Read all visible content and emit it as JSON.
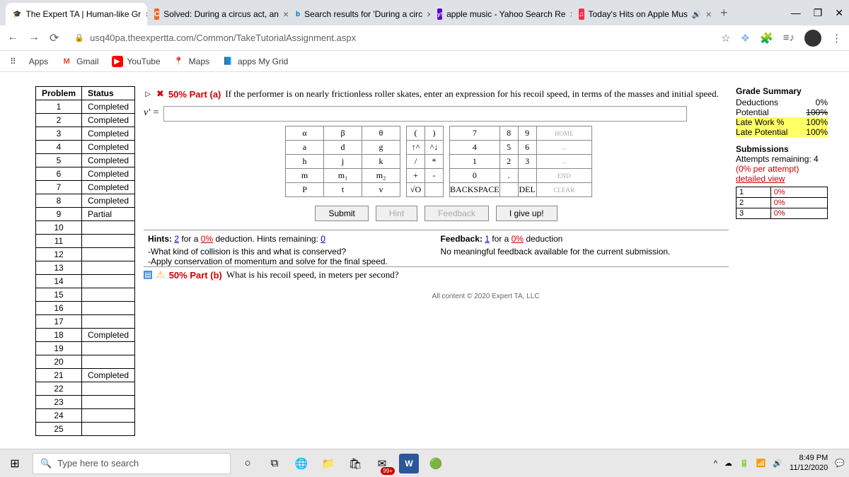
{
  "browser": {
    "tabs": [
      {
        "title": "The Expert TA | Human-like Gr",
        "favicon": "🎓"
      },
      {
        "title": "Solved: During a circus act, an",
        "favicon": "C"
      },
      {
        "title": "Search results for 'During a circ",
        "favicon": "b"
      },
      {
        "title": "apple music - Yahoo Search Re",
        "favicon": "y!"
      },
      {
        "title": "Today's Hits on Apple Mus",
        "favicon": "♫"
      }
    ],
    "url": "usq40pa.theexpertta.com/Common/TakeTutorialAssignment.aspx",
    "bookmarks_label": "Apps",
    "bookmarks": [
      {
        "label": "Gmail",
        "icon": "M"
      },
      {
        "label": "YouTube",
        "icon": "▶"
      },
      {
        "label": "Maps",
        "icon": "📍"
      },
      {
        "label": "apps My Grid",
        "icon": "📘"
      }
    ]
  },
  "status_header": {
    "col1": "Problem",
    "col2": "Status"
  },
  "status": [
    {
      "n": "1",
      "s": "Completed"
    },
    {
      "n": "2",
      "s": "Completed"
    },
    {
      "n": "3",
      "s": "Completed"
    },
    {
      "n": "4",
      "s": "Completed"
    },
    {
      "n": "5",
      "s": "Completed"
    },
    {
      "n": "6",
      "s": "Completed"
    },
    {
      "n": "7",
      "s": "Completed"
    },
    {
      "n": "8",
      "s": "Completed"
    },
    {
      "n": "9",
      "s": "Partial"
    },
    {
      "n": "10",
      "s": ""
    },
    {
      "n": "11",
      "s": ""
    },
    {
      "n": "12",
      "s": ""
    },
    {
      "n": "13",
      "s": ""
    },
    {
      "n": "14",
      "s": ""
    },
    {
      "n": "15",
      "s": ""
    },
    {
      "n": "16",
      "s": ""
    },
    {
      "n": "17",
      "s": ""
    },
    {
      "n": "18",
      "s": "Completed"
    },
    {
      "n": "19",
      "s": ""
    },
    {
      "n": "20",
      "s": ""
    },
    {
      "n": "21",
      "s": "Completed"
    },
    {
      "n": "22",
      "s": ""
    },
    {
      "n": "23",
      "s": ""
    },
    {
      "n": "24",
      "s": ""
    },
    {
      "n": "25",
      "s": ""
    }
  ],
  "part_a": {
    "label": "50% Part (a)",
    "text": "If the performer is on nearly frictionless roller skates, enter an expression for his recoil speed, in terms of the masses and initial speed.",
    "answer_prefix": "v' ="
  },
  "part_b": {
    "label": "50% Part (b)",
    "text": "What is his recoil speed, in meters per second?"
  },
  "grade": {
    "title": "Grade Summary",
    "rows": [
      {
        "k": "Deductions",
        "v": "0%"
      },
      {
        "k": "Potential",
        "v": "100%"
      },
      {
        "k": "Late Work %",
        "v": "100%"
      },
      {
        "k": "Late Potential",
        "v": "100%"
      }
    ],
    "sub_title": "Submissions",
    "attempts": "Attempts remaining: 4",
    "per": "(0% per attempt)",
    "detailed": "detailed view",
    "tries": [
      {
        "n": "1",
        "p": "0%"
      },
      {
        "n": "2",
        "p": "0%"
      },
      {
        "n": "3",
        "p": "0%"
      }
    ]
  },
  "keypad_greek": [
    [
      "α",
      "β",
      "θ"
    ],
    [
      "a",
      "d",
      "g"
    ],
    [
      "h",
      "j",
      "k"
    ],
    [
      "m",
      "m₁",
      "m₂"
    ],
    [
      "P",
      "t",
      "v"
    ]
  ],
  "keypad_paren": [
    [
      "(",
      ")"
    ],
    [
      "↑^",
      "^↓"
    ],
    [
      "/",
      "*"
    ],
    [
      "+",
      "-"
    ],
    [
      "√O",
      ""
    ]
  ],
  "keypad_num": [
    [
      "7",
      "8",
      "9",
      "HOME"
    ],
    [
      "4",
      "5",
      "6",
      "←"
    ],
    [
      "1",
      "2",
      "3",
      "→"
    ],
    [
      "0",
      ".",
      "",
      "END"
    ],
    [
      "BACKSPACE",
      "",
      "DEL",
      "CLEAR"
    ]
  ],
  "buttons": {
    "submit": "Submit",
    "hint": "Hint",
    "feedback": "Feedback",
    "giveup": "I give up!"
  },
  "hints": {
    "title": "Hints:",
    "count": "2",
    "mid": "for a",
    "pct": "0%",
    "tail": "deduction. Hints remaining:",
    "remain": "0",
    "line1": "-What kind of collision is this and what is conserved?",
    "line2": "-Apply conservation of momentum and solve for the final speed."
  },
  "feedback": {
    "title": "Feedback:",
    "count": "1",
    "mid": "for a",
    "pct": "0%",
    "tail": "deduction",
    "text": "No meaningful feedback available for the current submission."
  },
  "footer": "All content © 2020 Expert TA, LLC",
  "taskbar": {
    "search_placeholder": "Type here to search",
    "time": "8:49 PM",
    "date": "11/12/2020"
  }
}
